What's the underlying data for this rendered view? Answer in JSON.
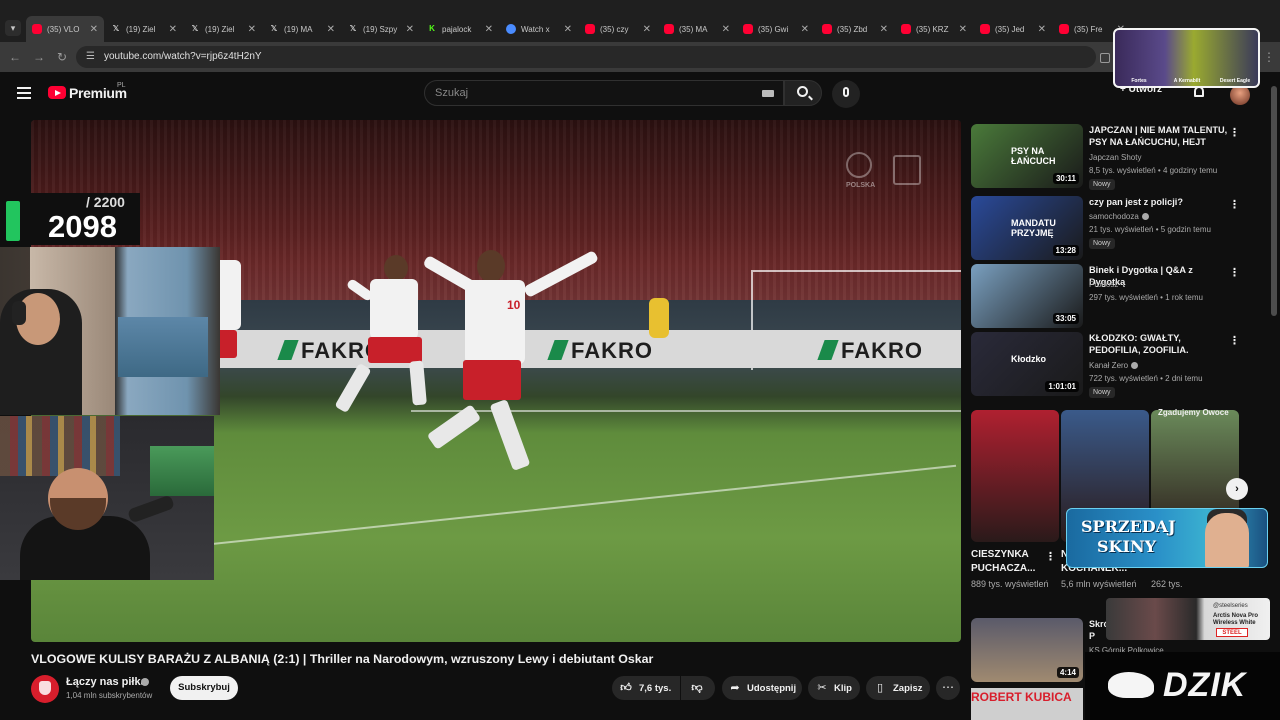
{
  "browser": {
    "tabs": [
      {
        "label": "(35) VLO",
        "icon": "youtube",
        "active": true
      },
      {
        "label": "(19) Ziel",
        "icon": "x"
      },
      {
        "label": "(19) Ziel",
        "icon": "x"
      },
      {
        "label": "(19) MA",
        "icon": "x"
      },
      {
        "label": "(19) Szpy",
        "icon": "x"
      },
      {
        "label": "pajalock",
        "icon": "kick"
      },
      {
        "label": "Watch x",
        "icon": "watch"
      },
      {
        "label": "(35) czy",
        "icon": "youtube"
      },
      {
        "label": "(35) MA",
        "icon": "youtube"
      },
      {
        "label": "(35) Gwi",
        "icon": "youtube"
      },
      {
        "label": "(35) Zbd",
        "icon": "youtube"
      },
      {
        "label": "(35) KRZ",
        "icon": "youtube"
      },
      {
        "label": "(35) Jed",
        "icon": "youtube"
      },
      {
        "label": "(35) Fre",
        "icon": "youtube"
      }
    ],
    "url": "youtube.com/watch?v=rjp6z4tH2nY"
  },
  "header": {
    "brand": "Premium",
    "region": "PL",
    "search_placeholder": "Szukaj",
    "create_label": "Utwórz"
  },
  "stream": {
    "counter_value": "2098",
    "counter_goal": "/ 2200"
  },
  "video": {
    "title": "VLOGOWE KULISY BARAŻU Z ALBANIĄ (2:1) | Thriller na Narodowym, wzruszony Lewy i debiutant Oskar",
    "channel": "Łączy nas piłka",
    "subscribers": "1,04 mln subskrybentów",
    "subscribe_label": "Subskrybuj",
    "likes": "7,6 tys.",
    "share_label": "Udostępnij",
    "clip_label": "Klip",
    "save_label": "Zapisz",
    "scene": {
      "shirt_number": "10",
      "adboard_text": "FAKRO",
      "watermark_text": "POLSKA"
    }
  },
  "recommendations": [
    {
      "title": "JAPCZAN | NIE MAM TALENTU, PSY NA ŁAŃCUCHU, HEJT NA...",
      "channel": "Japczan Shoty",
      "verified": false,
      "meta": "8,5 tys. wyświetleń • 4 godziny temu",
      "duration": "30:11",
      "badge": "Nowy",
      "thumb_text": "PSY NA ŁAŃCUCH",
      "thumb_color": "#4a7a3a"
    },
    {
      "title": "czy pan jest z policji?",
      "channel": "samochodoza",
      "verified": true,
      "meta": "21 tys. wyświetleń • 5 godzin temu",
      "duration": "13:28",
      "badge": "Nowy",
      "thumb_text": "MANDATU PRZYJMĘ",
      "thumb_color": "#2a4a9a"
    },
    {
      "title": "Binek i Dygotka | Q&A z Dygotką",
      "channel": "Pronosz",
      "verified": false,
      "meta": "297 tys. wyświetleń • 1 rok temu",
      "duration": "33:05",
      "badge": "",
      "thumb_text": "",
      "thumb_color": "#7aa0c0"
    },
    {
      "title": "KŁODZKO: GWAŁTY, PEDOFILIA, ZOOFILIA. WSTRZĄSAJĄCE ...",
      "channel": "Kanał Zero",
      "verified": true,
      "meta": "722 tys. wyświetleń • 2 dni temu",
      "duration": "1:01:01",
      "badge": "Nowy",
      "thumb_text": "Kłodzko",
      "thumb_color": "#2a2a3a"
    }
  ],
  "shorts": [
    {
      "title": "CIESZYNKA PUCHACZA...",
      "views": "889 tys. wyświetleń",
      "thumb_color": "#b02030"
    },
    {
      "title": "N KOCHANEK...",
      "views": "5,6 mln wyświetleń",
      "thumb_color": "#3a5a8a"
    },
    {
      "title": "owoce",
      "views": "262 tys.",
      "thumb_color": "#6a8a5a"
    }
  ],
  "shorts_overlay_text": "Zgadujemy Owoce",
  "rec_last": {
    "title": "Skró vs P",
    "channel": "KS Górnik Polkowice",
    "duration": "4:14",
    "strip_text": "ROBERT KUBICA"
  },
  "ads": {
    "overlay_cards": [
      "Fortes",
      "A Kernabilt",
      "Desert Eagle"
    ],
    "skin_banner_lines": [
      "SPRZEDAJ",
      "SKINY"
    ],
    "steelseries_handle": "@steelseries",
    "steelseries_product": "Arctis Nova Pro Wireless White",
    "steelseries_logo": "STEEL",
    "dzik_logo": "DZIK"
  },
  "colors": {
    "youtube_red": "#ff0033",
    "background": "#0f0f0f",
    "counter_green": "#22c55e"
  }
}
